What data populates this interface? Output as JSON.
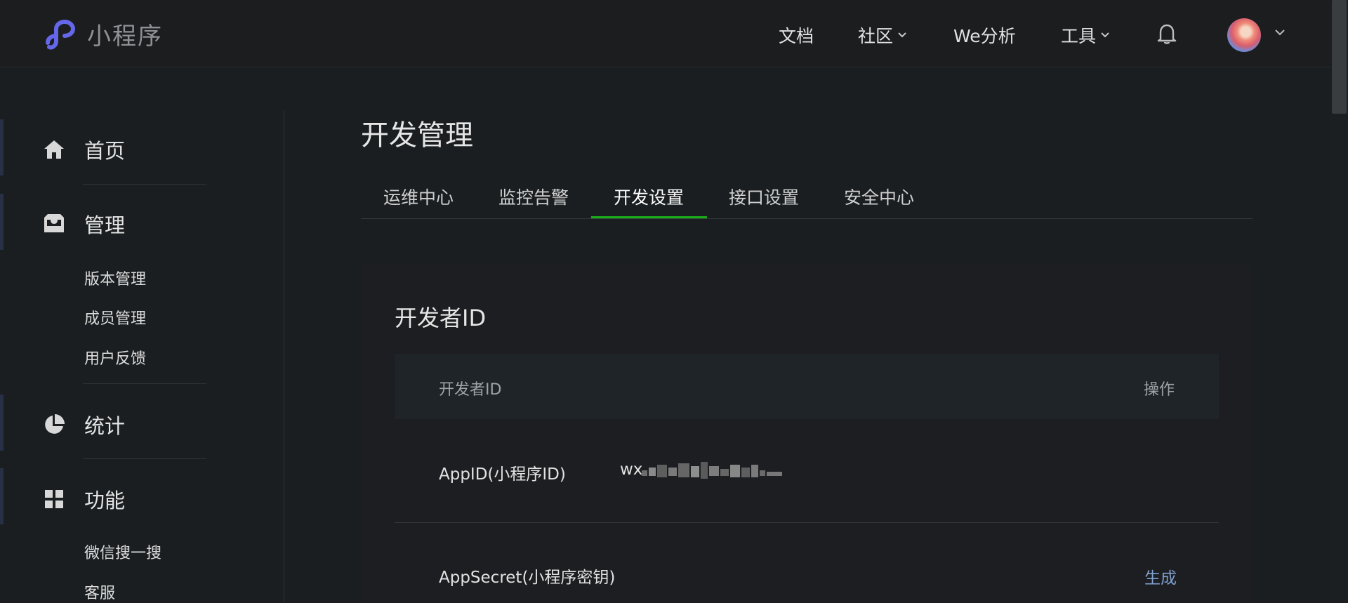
{
  "app": {
    "title": "小程序"
  },
  "header": {
    "nav": [
      {
        "label": "文档"
      },
      {
        "label": "社区"
      },
      {
        "label": "We分析"
      },
      {
        "label": "工具"
      }
    ]
  },
  "sidebar": {
    "items": [
      {
        "label": "首页",
        "icon": "home-icon"
      },
      {
        "label": "管理",
        "icon": "inbox-icon",
        "children": [
          "版本管理",
          "成员管理",
          "用户反馈"
        ]
      },
      {
        "label": "统计",
        "icon": "pie-chart-icon"
      },
      {
        "label": "功能",
        "icon": "grid-icon",
        "children": [
          "微信搜一搜",
          "客服"
        ]
      }
    ]
  },
  "main": {
    "title": "开发管理",
    "tabs": [
      {
        "label": "运维中心"
      },
      {
        "label": "监控告警"
      },
      {
        "label": "开发设置",
        "active": true
      },
      {
        "label": "接口设置"
      },
      {
        "label": "安全中心"
      }
    ],
    "card": {
      "title": "开发者ID",
      "columns": [
        "开发者ID",
        "操作"
      ],
      "rows": [
        {
          "name": "AppID(小程序ID)",
          "value": "wx"
        },
        {
          "name": "AppSecret(小程序密钥)",
          "action": "生成"
        }
      ]
    }
  },
  "colors": {
    "accent_green": "#1aad19",
    "link_blue": "#7fa0cf",
    "logo_purple": "#6468e8"
  }
}
